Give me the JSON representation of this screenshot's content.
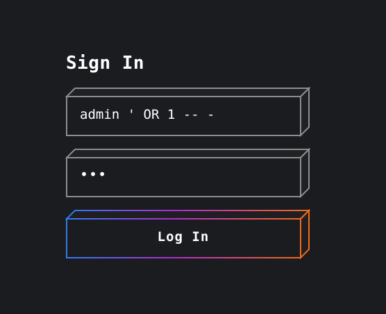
{
  "form": {
    "title": "Sign In",
    "username_value": "admin ' OR 1 -- -",
    "password_value": "•••",
    "login_label": "Log In"
  },
  "colors": {
    "background": "#1b1c1f",
    "input_border": "#8e8e8e",
    "button_gradient_start": "#2f7df0",
    "button_gradient_mid": "#b12bd6",
    "button_gradient_end": "#f26a1a"
  }
}
